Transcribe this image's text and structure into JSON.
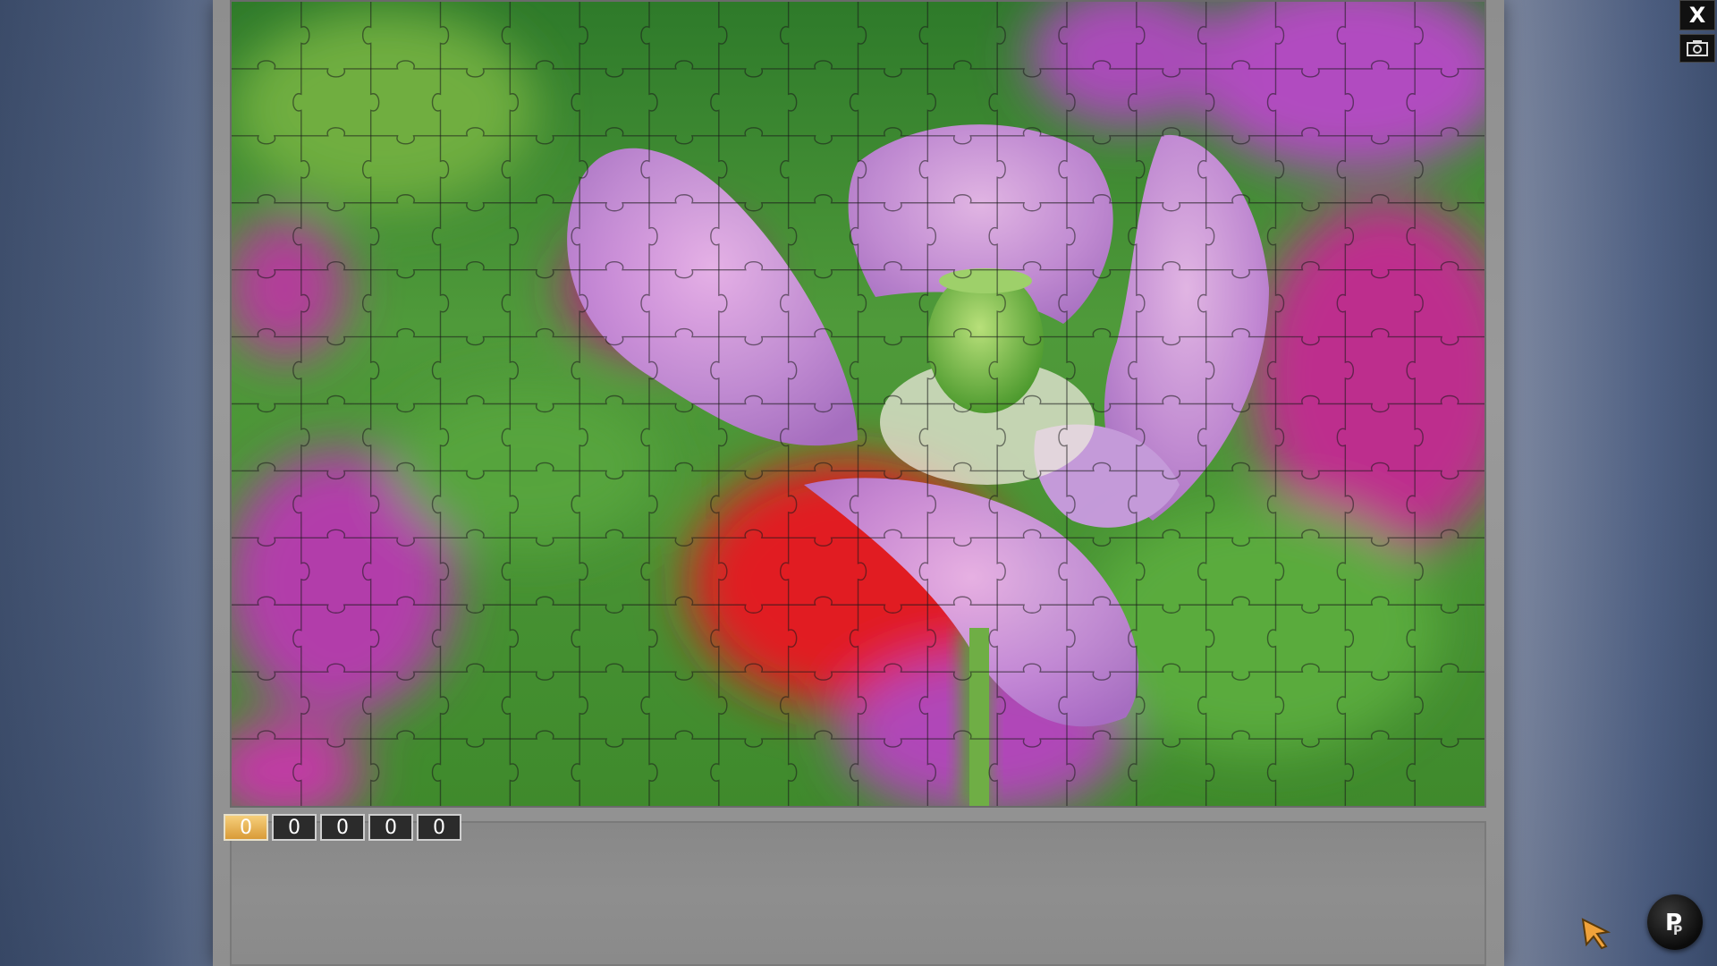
{
  "game": {
    "piece_grid": {
      "columns": 18,
      "rows": 12
    },
    "puzzle_image": "purple-poppy-flower-photo",
    "colors": {
      "panel": "#8e8e8e",
      "counter_active": "#e0a84a",
      "counter_idle": "#2b2b2b"
    }
  },
  "counter": {
    "digits": [
      "0",
      "0",
      "0",
      "0",
      "0"
    ]
  },
  "controls": {
    "close_label": "X",
    "screenshot_icon": "camera-icon"
  },
  "branding": {
    "logo_icon": "pp-logo-icon"
  }
}
